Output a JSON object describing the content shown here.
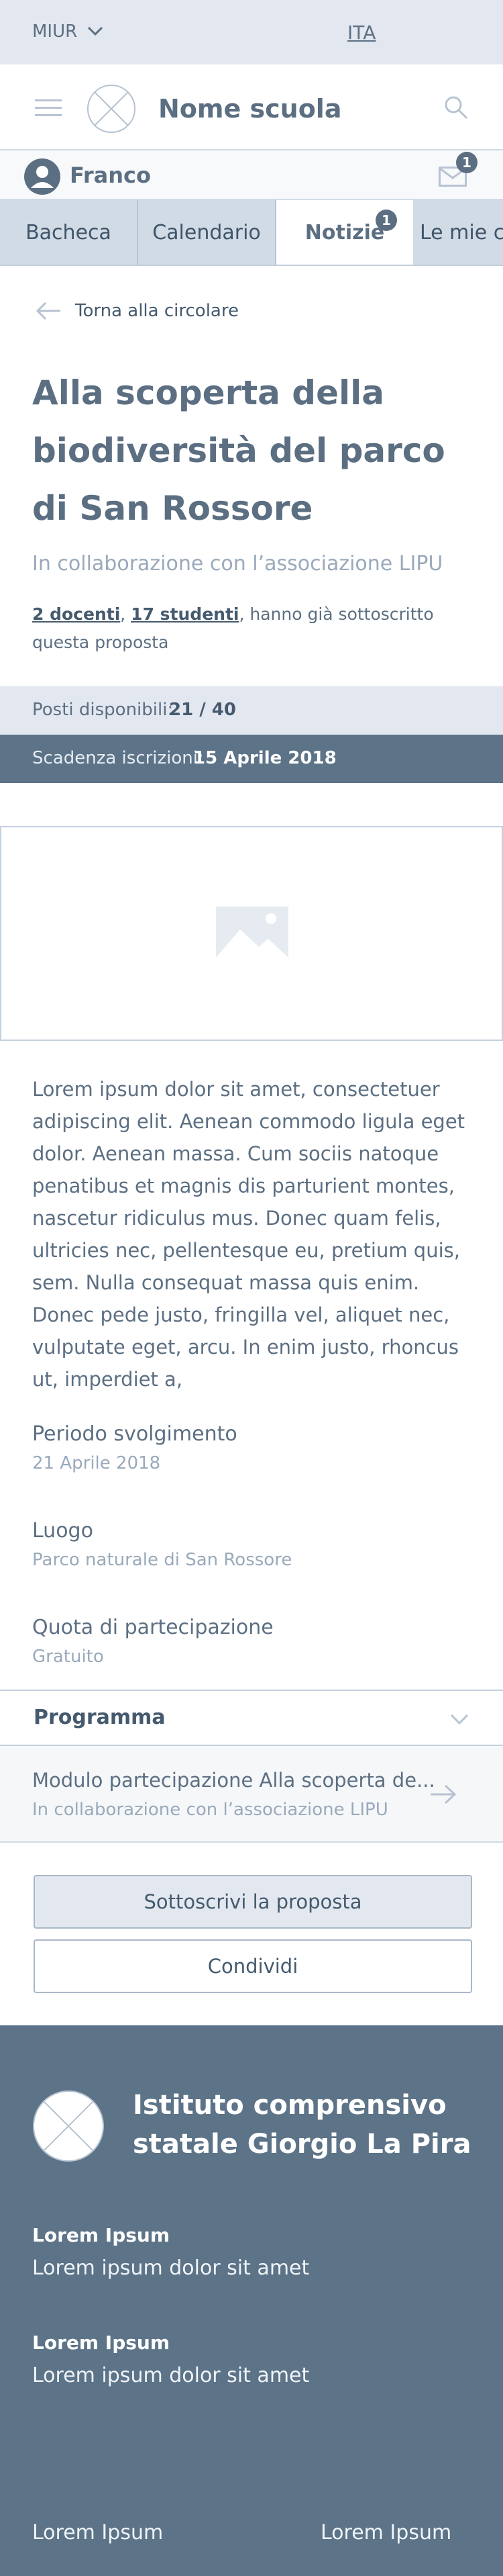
{
  "topbar": {
    "org": "MIUR",
    "lang": "ITA"
  },
  "header": {
    "school_name": "Nome scuola"
  },
  "user": {
    "name": "Franco",
    "messages_count": "1"
  },
  "tabs": [
    {
      "label": "Bacheca"
    },
    {
      "label": "Calendario"
    },
    {
      "label": "Notizie",
      "badge": "1"
    },
    {
      "label": "Le mie cl"
    }
  ],
  "back_label": "Torna alla circolare",
  "proposal": {
    "title": "Alla scoperta della biodiversità del parco di San Rossore",
    "subtitle": "In collaborazione con l’associazione LIPU",
    "teachers_link": "2 docenti",
    "comma1": ", ",
    "students_link": "17 studenti",
    "subscribed_suffix": ", hanno già sottoscritto questa proposta",
    "posts_label": "Posti disponibili:",
    "posts_value": "21 / 40",
    "deadline_label": "Scadenza iscrizioni:",
    "deadline_value": "15 Aprile 2018",
    "body": "Lorem ipsum dolor sit amet, consectetuer adipiscing elit. Aenean commodo ligula eget dolor. Aenean massa. Cum sociis natoque penatibus et magnis dis parturient montes, nascetur ridiculus mus. Donec quam felis, ultricies nec, pellentesque eu, pretium quis, sem. Nulla consequat massa quis enim. Donec pede justo, fringilla vel, aliquet nec, vulputate eget, arcu. In enim justo, rhoncus ut, imperdiet a,"
  },
  "details": {
    "period_label": "Periodo svolgimento",
    "period_value": "21 Aprile 2018",
    "place_label": "Luogo",
    "place_value": "Parco naturale di San Rossore",
    "fee_label": "Quota di partecipazione",
    "fee_value": "Gratuito"
  },
  "programma_label": "Programma",
  "attachment": {
    "title": "Modulo partecipazione Alla scoperta de...",
    "subtitle": "In collaborazione con l’associazione LIPU"
  },
  "buttons": {
    "subscribe": "Sottoscrivi la proposta",
    "share": "Condividi"
  },
  "footer": {
    "institute": "Istituto comprensivo statale Giorgio La Pira",
    "block1_title": "Lorem Ipsum",
    "block1_text": "Lorem ipsum dolor sit amet",
    "block2_title": "Lorem Ipsum",
    "block2_text": "Lorem ipsum dolor sit amet",
    "link_left": "Lorem Ipsum",
    "link_right": "Lorem Ipsum"
  },
  "colors": {
    "primary": "#5c6f82",
    "footer_bg": "#5c7388",
    "light_bg": "#e3e8f0"
  }
}
